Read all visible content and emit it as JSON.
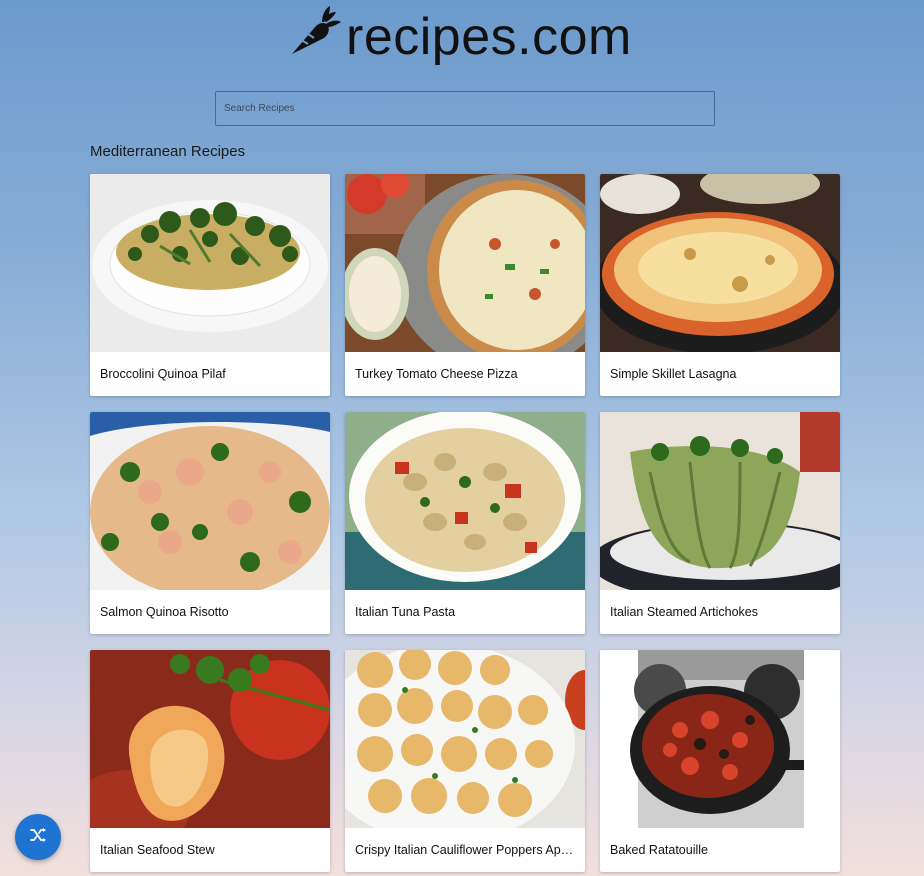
{
  "header": {
    "logo_icon": "carrot-icon",
    "site_title": "recipes.com"
  },
  "search": {
    "placeholder": "Search Recipes",
    "value": ""
  },
  "section": {
    "title": "Mediterranean Recipes"
  },
  "recipes": [
    {
      "title": "Broccolini Quinoa Pilaf",
      "image": "quinoa-broccolini-photo"
    },
    {
      "title": "Turkey Tomato Cheese Pizza",
      "image": "pizza-photo"
    },
    {
      "title": "Simple Skillet Lasagna",
      "image": "skillet-lasagna-photo"
    },
    {
      "title": "Salmon Quinoa Risotto",
      "image": "salmon-quinoa-photo"
    },
    {
      "title": "Italian Tuna Pasta",
      "image": "tuna-pasta-photo"
    },
    {
      "title": "Italian Steamed Artichokes",
      "image": "artichoke-photo"
    },
    {
      "title": "Italian Seafood Stew",
      "image": "seafood-stew-photo"
    },
    {
      "title": "Crispy Italian Cauliflower Poppers Appetizer",
      "image": "cauliflower-poppers-photo"
    },
    {
      "title": "Baked Ratatouille",
      "image": "ratatouille-photo"
    }
  ],
  "fab": {
    "icon": "shuffle-icon",
    "color": "#1f74d1"
  },
  "colors": {
    "background_top": "#6c9acc",
    "background_bottom": "#f1e0dc",
    "card": "#ffffff"
  }
}
